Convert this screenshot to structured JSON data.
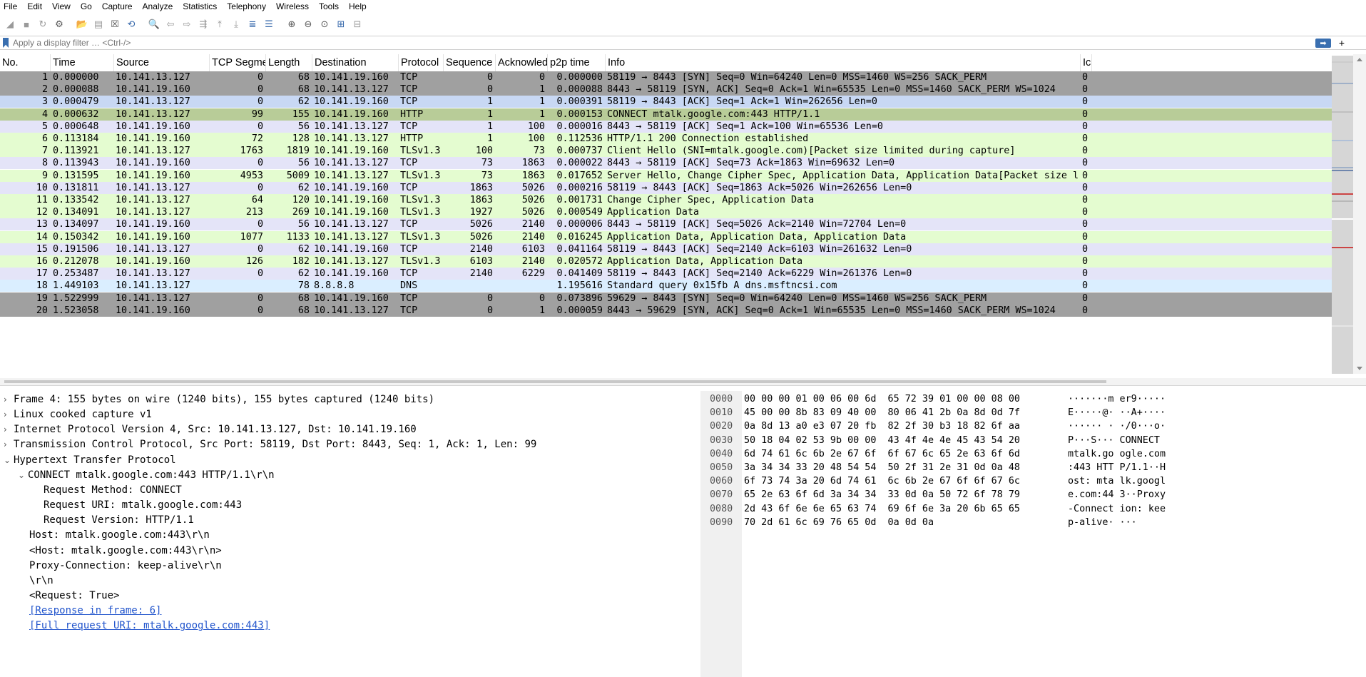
{
  "menu": [
    "File",
    "Edit",
    "View",
    "Go",
    "Capture",
    "Analyze",
    "Statistics",
    "Telephony",
    "Wireless",
    "Tools",
    "Help"
  ],
  "toolbar_icons": [
    {
      "name": "shark-fin-start-icon",
      "glyph": "◢",
      "cls": "gray"
    },
    {
      "name": "stop-capture-icon",
      "glyph": "■",
      "cls": "gray"
    },
    {
      "name": "restart-capture-icon",
      "glyph": "↻",
      "cls": "gray"
    },
    {
      "name": "capture-options-icon",
      "glyph": "⚙",
      "cls": ""
    },
    {
      "name": "open-file-icon",
      "glyph": "📂",
      "cls": ""
    },
    {
      "name": "save-file-icon",
      "glyph": "▤",
      "cls": "gray"
    },
    {
      "name": "close-file-icon",
      "glyph": "☒",
      "cls": ""
    },
    {
      "name": "reload-file-icon",
      "glyph": "⟲",
      "cls": "blue"
    },
    {
      "name": "find-packet-icon",
      "glyph": "🔍",
      "cls": ""
    },
    {
      "name": "go-back-icon",
      "glyph": "⇦",
      "cls": "gray"
    },
    {
      "name": "go-forward-icon",
      "glyph": "⇨",
      "cls": "gray"
    },
    {
      "name": "go-to-packet-icon",
      "glyph": "⇶",
      "cls": "gray"
    },
    {
      "name": "first-packet-icon",
      "glyph": "⤒",
      "cls": "gray"
    },
    {
      "name": "last-packet-icon",
      "glyph": "⤓",
      "cls": "gray"
    },
    {
      "name": "autoscroll-icon",
      "glyph": "≣",
      "cls": "blue"
    },
    {
      "name": "colorize-icon",
      "glyph": "☰",
      "cls": "blue"
    },
    {
      "name": "zoom-in-icon",
      "glyph": "⊕",
      "cls": ""
    },
    {
      "name": "zoom-out-icon",
      "glyph": "⊖",
      "cls": ""
    },
    {
      "name": "normal-size-icon",
      "glyph": "⊙",
      "cls": ""
    },
    {
      "name": "resize-columns-icon",
      "glyph": "⊞",
      "cls": "blue"
    },
    {
      "name": "layout-icon",
      "glyph": "⊟",
      "cls": "gray"
    }
  ],
  "filter": {
    "placeholder": "Apply a display filter … <Ctrl-/>",
    "apply": "➡",
    "add": "+"
  },
  "columns": [
    "No.",
    "Time",
    "Source",
    "TCP Segmen",
    "Length",
    "Destination",
    "Protocol",
    "Sequence N",
    "Acknowledg",
    "p2p time",
    "Info",
    "Ic"
  ],
  "packets": [
    {
      "no": "1",
      "time": "0.000000",
      "src": "10.141.13.127",
      "seg": "0",
      "len": "68",
      "dst": "10.141.19.160",
      "proto": "TCP",
      "seq": "0",
      "ack": "0",
      "p2p": "0.000000",
      "info": "58119 → 8443 [SYN] Seq=0 Win=64240 Len=0 MSS=1460 WS=256 SACK_PERM",
      "ic": "0:",
      "bg": "#a0a0a0"
    },
    {
      "no": "2",
      "time": "0.000088",
      "src": "10.141.19.160",
      "seg": "0",
      "len": "68",
      "dst": "10.141.13.127",
      "proto": "TCP",
      "seq": "0",
      "ack": "1",
      "p2p": "0.000088",
      "info": "8443 → 58119 [SYN, ACK] Seq=0 Ack=1 Win=65535 Len=0 MSS=1460 SACK_PERM WS=1024",
      "ic": "0:",
      "bg": "#a0a0a0"
    },
    {
      "no": "3",
      "time": "0.000479",
      "src": "10.141.13.127",
      "seg": "0",
      "len": "62",
      "dst": "10.141.19.160",
      "proto": "TCP",
      "seq": "1",
      "ack": "1",
      "p2p": "0.000391",
      "info": "58119 → 8443 [ACK] Seq=1 Ack=1 Win=262656 Len=0",
      "ic": "0:",
      "bg": "#c8d8f4"
    },
    {
      "no": "4",
      "time": "0.000632",
      "src": "10.141.13.127",
      "seg": "99",
      "len": "155",
      "dst": "10.141.19.160",
      "proto": "HTTP",
      "seq": "1",
      "ack": "1",
      "p2p": "0.000153",
      "info": "CONNECT mtalk.google.com:443 HTTP/1.1",
      "ic": "0:",
      "bg": "#b8cc98"
    },
    {
      "no": "5",
      "time": "0.000648",
      "src": "10.141.19.160",
      "seg": "0",
      "len": "56",
      "dst": "10.141.13.127",
      "proto": "TCP",
      "seq": "1",
      "ack": "100",
      "p2p": "0.000016",
      "info": "8443 → 58119 [ACK] Seq=1 Ack=100 Win=65536 Len=0",
      "ic": "0:",
      "bg": "#e4e4f8"
    },
    {
      "no": "6",
      "time": "0.113184",
      "src": "10.141.19.160",
      "seg": "72",
      "len": "128",
      "dst": "10.141.13.127",
      "proto": "HTTP",
      "seq": "1",
      "ack": "100",
      "p2p": "0.112536",
      "info": "HTTP/1.1 200 Connection established",
      "ic": "0:",
      "bg": "#e4fcd0"
    },
    {
      "no": "7",
      "time": "0.113921",
      "src": "10.141.13.127",
      "seg": "1763",
      "len": "1819",
      "dst": "10.141.19.160",
      "proto": "TLSv1.3",
      "seq": "100",
      "ack": "73",
      "p2p": "0.000737",
      "info": "Client Hello (SNI=mtalk.google.com)[Packet size limited during capture]",
      "ic": "0:",
      "bg": "#e4fcd0"
    },
    {
      "no": "8",
      "time": "0.113943",
      "src": "10.141.19.160",
      "seg": "0",
      "len": "56",
      "dst": "10.141.13.127",
      "proto": "TCP",
      "seq": "73",
      "ack": "1863",
      "p2p": "0.000022",
      "info": "8443 → 58119 [ACK] Seq=73 Ack=1863 Win=69632 Len=0",
      "ic": "0:",
      "bg": "#e4e4f8"
    },
    {
      "no": "9",
      "time": "0.131595",
      "src": "10.141.19.160",
      "seg": "4953",
      "len": "5009",
      "dst": "10.141.13.127",
      "proto": "TLSv1.3",
      "seq": "73",
      "ack": "1863",
      "p2p": "0.017652",
      "info": "Server Hello, Change Cipher Spec, Application Data, Application Data[Packet size limited d…",
      "ic": "0:",
      "bg": "#e4fcd0"
    },
    {
      "no": "10",
      "time": "0.131811",
      "src": "10.141.13.127",
      "seg": "0",
      "len": "62",
      "dst": "10.141.19.160",
      "proto": "TCP",
      "seq": "1863",
      "ack": "5026",
      "p2p": "0.000216",
      "info": "58119 → 8443 [ACK] Seq=1863 Ack=5026 Win=262656 Len=0",
      "ic": "0:",
      "bg": "#e4e4f8"
    },
    {
      "no": "11",
      "time": "0.133542",
      "src": "10.141.13.127",
      "seg": "64",
      "len": "120",
      "dst": "10.141.19.160",
      "proto": "TLSv1.3",
      "seq": "1863",
      "ack": "5026",
      "p2p": "0.001731",
      "info": "Change Cipher Spec, Application Data",
      "ic": "0:",
      "bg": "#e4fcd0"
    },
    {
      "no": "12",
      "time": "0.134091",
      "src": "10.141.13.127",
      "seg": "213",
      "len": "269",
      "dst": "10.141.19.160",
      "proto": "TLSv1.3",
      "seq": "1927",
      "ack": "5026",
      "p2p": "0.000549",
      "info": "Application Data",
      "ic": "0:",
      "bg": "#e4fcd0"
    },
    {
      "no": "13",
      "time": "0.134097",
      "src": "10.141.19.160",
      "seg": "0",
      "len": "56",
      "dst": "10.141.13.127",
      "proto": "TCP",
      "seq": "5026",
      "ack": "2140",
      "p2p": "0.000006",
      "info": "8443 → 58119 [ACK] Seq=5026 Ack=2140 Win=72704 Len=0",
      "ic": "0:",
      "bg": "#e4e4f8"
    },
    {
      "no": "14",
      "time": "0.150342",
      "src": "10.141.19.160",
      "seg": "1077",
      "len": "1133",
      "dst": "10.141.13.127",
      "proto": "TLSv1.3",
      "seq": "5026",
      "ack": "2140",
      "p2p": "0.016245",
      "info": "Application Data, Application Data, Application Data",
      "ic": "0:",
      "bg": "#e4fcd0"
    },
    {
      "no": "15",
      "time": "0.191506",
      "src": "10.141.13.127",
      "seg": "0",
      "len": "62",
      "dst": "10.141.19.160",
      "proto": "TCP",
      "seq": "2140",
      "ack": "6103",
      "p2p": "0.041164",
      "info": "58119 → 8443 [ACK] Seq=2140 Ack=6103 Win=261632 Len=0",
      "ic": "0:",
      "bg": "#e4e4f8"
    },
    {
      "no": "16",
      "time": "0.212078",
      "src": "10.141.19.160",
      "seg": "126",
      "len": "182",
      "dst": "10.141.13.127",
      "proto": "TLSv1.3",
      "seq": "6103",
      "ack": "2140",
      "p2p": "0.020572",
      "info": "Application Data, Application Data",
      "ic": "0:",
      "bg": "#e4fcd0"
    },
    {
      "no": "17",
      "time": "0.253487",
      "src": "10.141.13.127",
      "seg": "0",
      "len": "62",
      "dst": "10.141.19.160",
      "proto": "TCP",
      "seq": "2140",
      "ack": "6229",
      "p2p": "0.041409",
      "info": "58119 → 8443 [ACK] Seq=2140 Ack=6229 Win=261376 Len=0",
      "ic": "0:",
      "bg": "#e4e4f8"
    },
    {
      "no": "18",
      "time": "1.449103",
      "src": "10.141.13.127",
      "seg": "",
      "len": "78",
      "dst": "8.8.8.8",
      "proto": "DNS",
      "seq": "",
      "ack": "",
      "p2p": "1.195616",
      "info": "Standard query 0x15fb A dns.msftncsi.com",
      "ic": "0:",
      "bg": "#daeeff"
    },
    {
      "no": "19",
      "time": "1.522999",
      "src": "10.141.13.127",
      "seg": "0",
      "len": "68",
      "dst": "10.141.19.160",
      "proto": "TCP",
      "seq": "0",
      "ack": "0",
      "p2p": "0.073896",
      "info": "59629 → 8443 [SYN] Seq=0 Win=64240 Len=0 MSS=1460 WS=256 SACK_PERM",
      "ic": "0:",
      "bg": "#a0a0a0"
    },
    {
      "no": "20",
      "time": "1.523058",
      "src": "10.141.19.160",
      "seg": "0",
      "len": "68",
      "dst": "10.141.13.127",
      "proto": "TCP",
      "seq": "0",
      "ack": "1",
      "p2p": "0.000059",
      "info": "8443 → 59629 [SYN, ACK] Seq=0 Ack=1 Win=65535 Len=0 MSS=1460 SACK_PERM WS=1024",
      "ic": "0:",
      "bg": "#a0a0a0"
    }
  ],
  "tree": [
    {
      "text": "Frame 4: 155 bytes on wire (1240 bits), 155 bytes captured (1240 bits)",
      "caret": "›",
      "indent": 0,
      "link": false
    },
    {
      "text": "Linux cooked capture v1",
      "caret": "›",
      "indent": 0,
      "link": false
    },
    {
      "text": "Internet Protocol Version 4, Src: 10.141.13.127, Dst: 10.141.19.160",
      "caret": "›",
      "indent": 0,
      "link": false
    },
    {
      "text": "Transmission Control Protocol, Src Port: 58119, Dst Port: 8443, Seq: 1, Ack: 1, Len: 99",
      "caret": "›",
      "indent": 0,
      "link": false
    },
    {
      "text": "Hypertext Transfer Protocol",
      "caret": "⌄",
      "indent": 0,
      "link": false
    },
    {
      "text": "CONNECT mtalk.google.com:443 HTTP/1.1\\r\\n",
      "caret": "⌄",
      "indent": 1,
      "link": false
    },
    {
      "text": "Request Method: CONNECT",
      "caret": "",
      "indent": 2,
      "link": false
    },
    {
      "text": "Request URI: mtalk.google.com:443",
      "caret": "",
      "indent": 2,
      "link": false
    },
    {
      "text": "Request Version: HTTP/1.1",
      "caret": "",
      "indent": 2,
      "link": false
    },
    {
      "text": "Host: mtalk.google.com:443\\r\\n",
      "caret": "",
      "indent": 1,
      "link": false
    },
    {
      "text": "<Host: mtalk.google.com:443\\r\\n>",
      "caret": "",
      "indent": 1,
      "link": false
    },
    {
      "text": "Proxy-Connection: keep-alive\\r\\n",
      "caret": "",
      "indent": 1,
      "link": false
    },
    {
      "text": "\\r\\n",
      "caret": "",
      "indent": 1,
      "link": false
    },
    {
      "text": "<Request: True>",
      "caret": "",
      "indent": 1,
      "link": false
    },
    {
      "text": "[Response in frame: 6]",
      "caret": "",
      "indent": 1,
      "link": true
    },
    {
      "text": "[Full request URI: mtalk.google.com:443]",
      "caret": "",
      "indent": 1,
      "link": true
    }
  ],
  "hex": [
    {
      "off": "0000",
      "hex": "00 00 00 01 00 06 00 6d  65 72 39 01 00 00 08 00",
      "ascii": "·······m er9·····"
    },
    {
      "off": "0010",
      "hex": "45 00 00 8b 83 09 40 00  80 06 41 2b 0a 8d 0d 7f",
      "ascii": "E·····@· ··A+····"
    },
    {
      "off": "0020",
      "hex": "0a 8d 13 a0 e3 07 20 fb  82 2f 30 b3 18 82 6f aa",
      "ascii": "······ · ·/0···o·"
    },
    {
      "off": "0030",
      "hex": "50 18 04 02 53 9b 00 00  43 4f 4e 4e 45 43 54 20",
      "ascii": "P···S··· CONNECT "
    },
    {
      "off": "0040",
      "hex": "6d 74 61 6c 6b 2e 67 6f  6f 67 6c 65 2e 63 6f 6d",
      "ascii": "mtalk.go ogle.com"
    },
    {
      "off": "0050",
      "hex": "3a 34 34 33 20 48 54 54  50 2f 31 2e 31 0d 0a 48",
      "ascii": ":443 HTT P/1.1··H"
    },
    {
      "off": "0060",
      "hex": "6f 73 74 3a 20 6d 74 61  6c 6b 2e 67 6f 6f 67 6c",
      "ascii": "ost: mta lk.googl"
    },
    {
      "off": "0070",
      "hex": "65 2e 63 6f 6d 3a 34 34  33 0d 0a 50 72 6f 78 79",
      "ascii": "e.com:44 3··Proxy"
    },
    {
      "off": "0080",
      "hex": "2d 43 6f 6e 6e 65 63 74  69 6f 6e 3a 20 6b 65 65",
      "ascii": "-Connect ion: kee"
    },
    {
      "off": "0090",
      "hex": "70 2d 61 6c 69 76 65 0d  0a 0d 0a",
      "ascii": "p-alive· ···"
    }
  ],
  "colors": {
    "selected": "#b8cc98",
    "syn": "#a0a0a0",
    "tcp": "#e4e4f8",
    "tls": "#e4fcd0",
    "dns": "#daeeff",
    "link": "#2255cc"
  }
}
